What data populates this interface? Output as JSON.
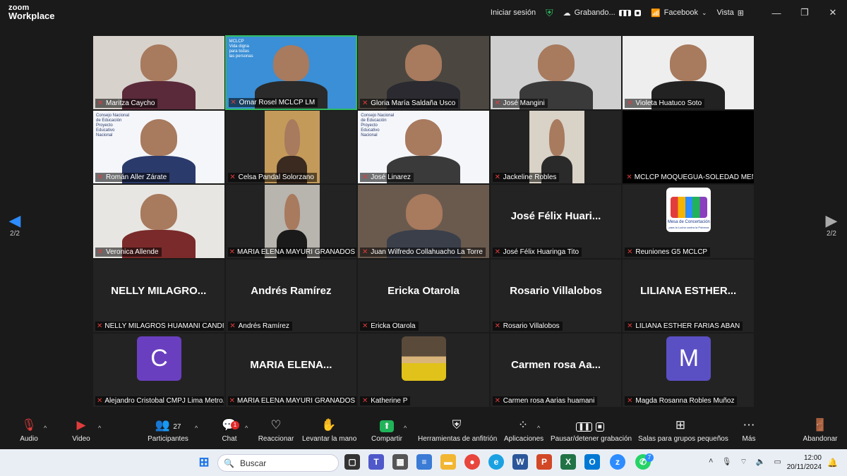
{
  "app": {
    "brand_top": "zoom",
    "brand_bottom": "Workplace"
  },
  "topbar": {
    "login": "Iniciar sesión",
    "recording": "Grabando...",
    "stream": "Facebook",
    "view": "Vista",
    "window_controls": [
      "minimize-icon",
      "restore-icon",
      "close-icon"
    ]
  },
  "pager": {
    "left": "2/2",
    "right": "2/2"
  },
  "participants": [
    {
      "label": "Maritza Caycho",
      "type": "video",
      "muted": true
    },
    {
      "label": "Omar Rosel MCLCP LM",
      "type": "video",
      "muted": true,
      "active": true,
      "overlay": [
        "MCLCP",
        "Vida digna",
        "para todas",
        "las personas"
      ]
    },
    {
      "label": "Gloria María Saldaña Usco",
      "type": "video",
      "muted": true
    },
    {
      "label": "José Mangini",
      "type": "video",
      "muted": true
    },
    {
      "label": "Violeta Huatuco Soto",
      "type": "video",
      "muted": true
    },
    {
      "label": "Román Aller Zárate",
      "type": "video",
      "muted": true,
      "overlay": [
        "Consejo Nacional",
        "de Educación",
        "Proyecto",
        "Educativo",
        "Nacional"
      ]
    },
    {
      "label": "Celsa Pandal Solorzano",
      "type": "video",
      "muted": true
    },
    {
      "label": "José Linarez",
      "type": "video",
      "muted": true,
      "overlay": [
        "Consejo Nacional",
        "de Educación",
        "Proyecto",
        "Educativo",
        "Nacional"
      ]
    },
    {
      "label": "Jackeline Robles",
      "type": "video",
      "muted": true
    },
    {
      "label": "MCLCP MOQUEGUA-SOLEDAD MEN...",
      "type": "black",
      "muted": true
    },
    {
      "label": "Veronica Allende",
      "type": "video",
      "muted": true
    },
    {
      "label": "MARIA ELENA MAYURI GRANADOS",
      "type": "video",
      "muted": true
    },
    {
      "label": "Juan Wilfredo Collahuacho La Torre",
      "type": "video",
      "muted": true
    },
    {
      "label": "José Félix Huaringa Tito",
      "type": "name",
      "big": "José  Félix  Huari...",
      "muted": true
    },
    {
      "label": "Reuniones G5 MCLCP",
      "type": "logo",
      "muted": true,
      "overlay": [
        "Mesa de Concertación",
        "para la Lucha contra la Pobreza"
      ]
    },
    {
      "label": "NELLY MILAGROS HUAMANI CANDIA",
      "type": "name",
      "big": "NELLY  MILAGRO...",
      "muted": true
    },
    {
      "label": "Andrés Ramírez",
      "type": "name",
      "big": "Andrés  Ramírez",
      "muted": true
    },
    {
      "label": "Ericka Otarola",
      "type": "name",
      "big": "Ericka  Otarola",
      "muted": true
    },
    {
      "label": "Rosario Villalobos",
      "type": "name",
      "big": "Rosario  Villalobos",
      "muted": true
    },
    {
      "label": "LILIANA ESTHER FARIAS ABAN",
      "type": "name",
      "big": "LILIANA  ESTHER...",
      "muted": true
    },
    {
      "label": "Alejandro Cristobal CMPJ Lima Metro...",
      "type": "avatar",
      "initial": "C",
      "color": "#6a3fbf",
      "muted": true
    },
    {
      "label": "MARIA ELENA MAYURI GRANADOS",
      "type": "name",
      "big": "MARIA  ELENA...",
      "muted": true
    },
    {
      "label": "Katherine P",
      "type": "photo",
      "muted": true
    },
    {
      "label": "Carmen rosa Aarias huamani",
      "type": "name",
      "big": "Carmen  rosa  Aa...",
      "muted": true
    },
    {
      "label": "Magda Rosanna Robles Muñoz",
      "type": "avatar",
      "initial": "M",
      "color": "#5b4fc4",
      "muted": true
    }
  ],
  "toolbar": {
    "audio": "Audio",
    "video": "Video",
    "participants": "Participantes",
    "participants_count": "27",
    "chat": "Chat",
    "chat_badge": "1",
    "reactions": "Reaccionar",
    "raise_hand": "Levantar la mano",
    "share": "Compartir",
    "host_tools": "Herramientas de anfitrión",
    "apps": "Aplicaciones",
    "pause_recording": "Pausar/detener grabación",
    "breakout": "Salas para grupos pequeños",
    "more": "Más",
    "leave": "Abandonar",
    "colors": {
      "share": "#21b35a",
      "mic_off": "#e03c3c",
      "leave": "#e03c3c"
    }
  },
  "taskbar": {
    "search_placeholder": "Buscar",
    "time": "12:00",
    "date": "20/11/2024",
    "whatsapp_badge": "7",
    "apps": [
      "windows-icon",
      "task-view-icon",
      "teams-icon",
      "calculator-icon",
      "notepad-icon",
      "file-explorer-icon",
      "chrome-icon",
      "edge-icon",
      "word-icon",
      "powerpoint-icon",
      "excel-icon",
      "outlook-icon",
      "zoom-icon",
      "whatsapp-icon"
    ]
  }
}
